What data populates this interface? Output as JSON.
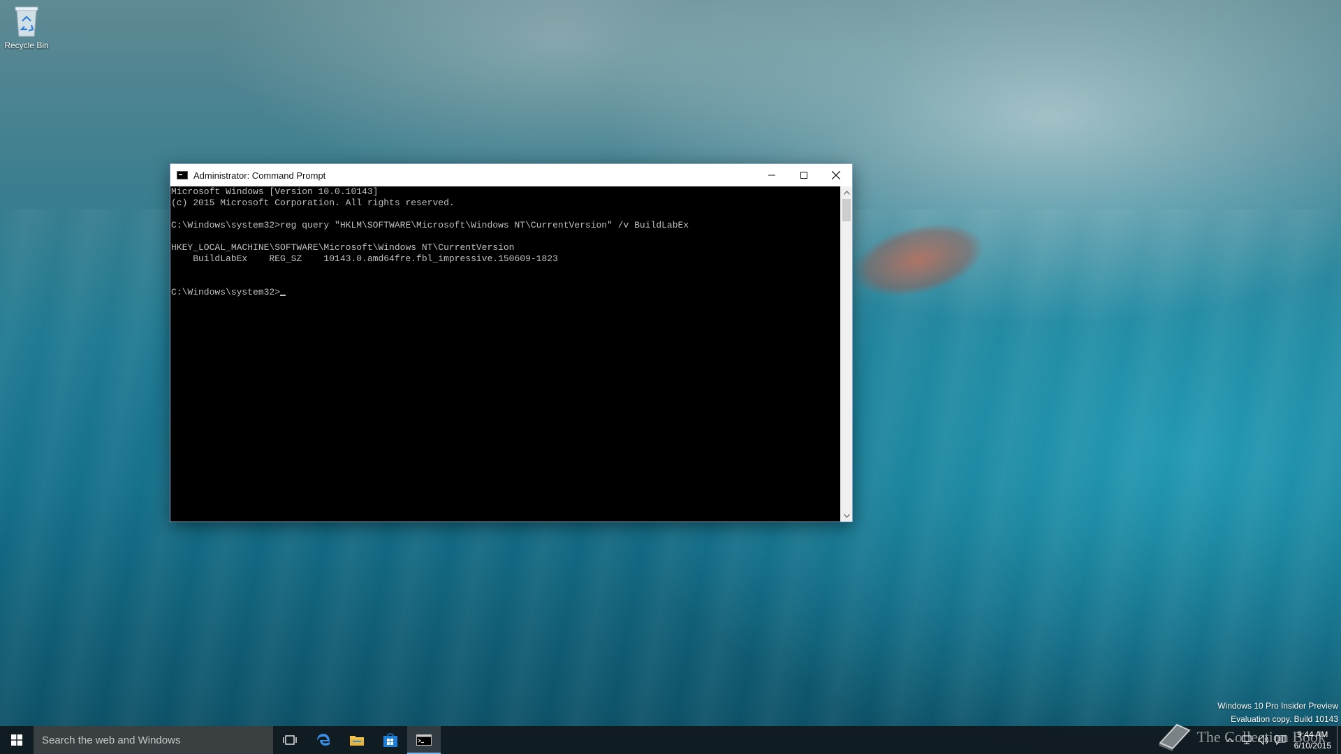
{
  "desktop": {
    "icons": [
      {
        "label": "Recycle Bin",
        "icon": "recycle-bin-icon"
      }
    ]
  },
  "window": {
    "title": "Administrator: Command Prompt",
    "controls": [
      "minimize",
      "maximize",
      "close"
    ],
    "console_lines": [
      "Microsoft Windows [Version 10.0.10143]",
      "(c) 2015 Microsoft Corporation. All rights reserved.",
      "",
      "C:\\Windows\\system32>reg query \"HKLM\\SOFTWARE\\Microsoft\\Windows NT\\CurrentVersion\" /v BuildLabEx",
      "",
      "HKEY_LOCAL_MACHINE\\SOFTWARE\\Microsoft\\Windows NT\\CurrentVersion",
      "    BuildLabEx    REG_SZ    10143.0.amd64fre.fbl_impressive.150609-1823",
      "",
      ""
    ],
    "prompt": "C:\\Windows\\system32>"
  },
  "watermark": {
    "line1": "Windows 10 Pro Insider Preview",
    "line2": "Evaluation copy. Build 10143"
  },
  "taskbar": {
    "search_placeholder": "Search the web and Windows",
    "apps": [
      "task-view",
      "edge",
      "file-explorer",
      "store",
      "command-prompt"
    ],
    "active_app": "command-prompt",
    "clock_time": "9:44 AM",
    "clock_date": "6/10/2015"
  },
  "brand_watermark": "The Collection Book",
  "colors": {
    "console_bg": "#000000",
    "console_text": "#c0c0c0",
    "taskbar_accent": "#76b9ed"
  }
}
